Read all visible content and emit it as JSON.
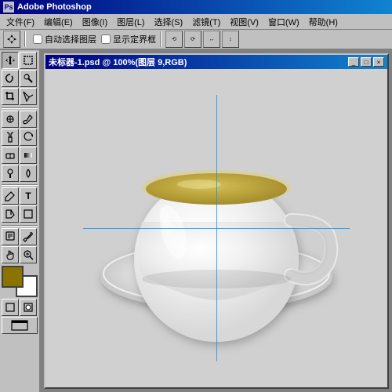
{
  "app": {
    "title": "Adobe Photoshop",
    "icon": "PS"
  },
  "menu": {
    "items": [
      {
        "label": "文件(F)"
      },
      {
        "label": "编辑(E)"
      },
      {
        "label": "图像(I)"
      },
      {
        "label": "图层(L)"
      },
      {
        "label": "选择(S)"
      },
      {
        "label": "滤镜(T)"
      },
      {
        "label": "视图(V)"
      },
      {
        "label": "窗口(W)"
      },
      {
        "label": "帮助(H)"
      }
    ]
  },
  "toolbar": {
    "auto_select_label": "自动选择图层",
    "show_bounds_label": "显示定界框"
  },
  "document": {
    "title": "未标器-1.psd @ 100%(图层 9,RGB)"
  },
  "window_controls": {
    "minimize": "_",
    "maximize": "□",
    "close": "×"
  },
  "tools": [
    {
      "name": "move",
      "icon": "✛"
    },
    {
      "name": "marquee-rect",
      "icon": "⬚"
    },
    {
      "name": "lasso",
      "icon": "⌇"
    },
    {
      "name": "magic-wand",
      "icon": "✦"
    },
    {
      "name": "crop",
      "icon": "⊡"
    },
    {
      "name": "slice",
      "icon": "⊘"
    },
    {
      "name": "healing",
      "icon": "✚"
    },
    {
      "name": "brush",
      "icon": "𝄘"
    },
    {
      "name": "stamp",
      "icon": "⬡"
    },
    {
      "name": "history-brush",
      "icon": "↺"
    },
    {
      "name": "eraser",
      "icon": "▭"
    },
    {
      "name": "gradient",
      "icon": "▦"
    },
    {
      "name": "dodge",
      "icon": "○"
    },
    {
      "name": "pen",
      "icon": "𝄋"
    },
    {
      "name": "type",
      "icon": "T"
    },
    {
      "name": "path-select",
      "icon": "↖"
    },
    {
      "name": "shape",
      "icon": "◻"
    },
    {
      "name": "notes",
      "icon": "✎"
    },
    {
      "name": "eyedropper",
      "icon": "⊘"
    },
    {
      "name": "hand",
      "icon": "✋"
    },
    {
      "name": "zoom",
      "icon": "⊕"
    }
  ],
  "colors": {
    "foreground": "#8B7300",
    "background": "#ffffff",
    "canvas_bg": "#d0d0d0",
    "guide_color": "#0096ff",
    "saucer_color": "#e8e8e8",
    "cup_color": "#f0f0f0",
    "tea_color": "#c8b850"
  }
}
